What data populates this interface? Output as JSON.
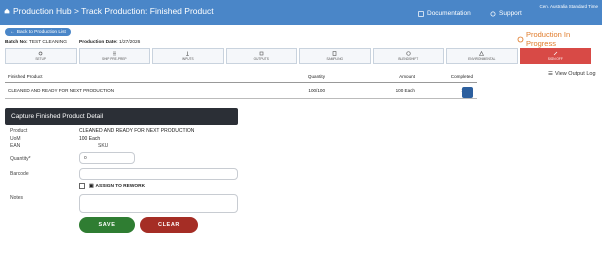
{
  "header": {
    "crumb": "Production Hub > Track Production: Finished Product",
    "links": [
      {
        "label": "Documentation",
        "icon": "book-icon"
      },
      {
        "label": "Support",
        "icon": "headset-icon"
      }
    ],
    "timezone": "Cen. Australia Standard Time"
  },
  "back_label": "Back to Production List",
  "status": "Production In Progress",
  "batch": {
    "no_label": "Batch No:",
    "no_value": "TEST CLEANING",
    "date_label": "Production Date:",
    "date_value": "1/27/2026"
  },
  "tabs": [
    {
      "label": "Setup",
      "icon": "gear-icon",
      "active": false
    },
    {
      "label": "Ship Pre-Prep",
      "icon": "list-icon",
      "active": false
    },
    {
      "label": "Inputs",
      "icon": "scale-icon",
      "active": false
    },
    {
      "label": "Outputs",
      "icon": "box-icon",
      "active": false
    },
    {
      "label": "Sampling",
      "icon": "clipboard-icon",
      "active": false
    },
    {
      "label": "Blendshift",
      "icon": "blend-icon",
      "active": false
    },
    {
      "label": "Environmental",
      "icon": "warning-icon",
      "active": false
    },
    {
      "label": "Sign Off",
      "icon": "pen-icon",
      "active": true
    }
  ],
  "view_log": "View Output Log",
  "table": {
    "headers": [
      "Finished Product",
      "Quantity",
      "Amount",
      "Completed"
    ],
    "rows": [
      [
        "CLEANED AND READY FOR NEXT PRODUCTION",
        "100/100",
        "100 Each",
        "100%"
      ]
    ]
  },
  "panel": {
    "title": "Capture Finished Product Detail",
    "product_label": "Product",
    "product_value": "CLEANED AND READY FOR NEXT PRODUCTION",
    "uom_label": "UoM",
    "uom_value": "100 Each",
    "ean_label": "EAN",
    "sku_label": "SKU",
    "qty_label": "Quantity*",
    "qty_value": "0",
    "barcode_label": "Barcode",
    "rework_label": "ASSIGN TO REWORK",
    "notes_label": "Notes",
    "save": "SAVE",
    "clear": "CLEAR"
  },
  "colors": {
    "accent": "#4a86c8",
    "status": "#e07b2a",
    "active_tab": "#d84a46",
    "save": "#2f7d32",
    "clear": "#a52d25"
  }
}
